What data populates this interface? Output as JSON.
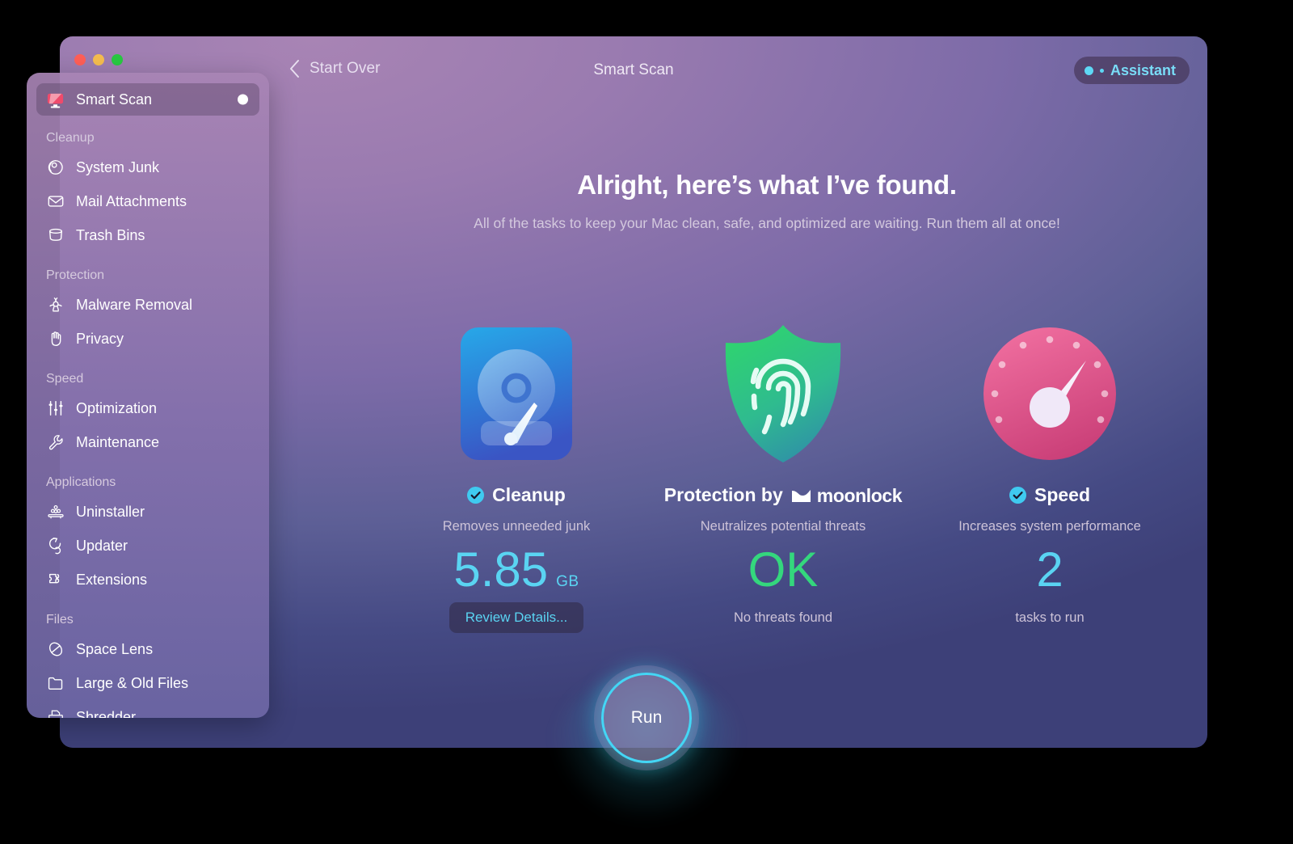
{
  "window": {
    "title": "Smart Scan",
    "back_label": "Start Over",
    "assistant_label": "Assistant",
    "traffic_lights": [
      "close",
      "minimize",
      "zoom"
    ]
  },
  "hero": {
    "headline": "Alright, here’s what I’ve found.",
    "subtext": "All of the tasks to keep your Mac clean, safe, and optimized are waiting. Run them all at once!"
  },
  "cards": [
    {
      "id": "cleanup",
      "icon": "hard-drive-icon",
      "title": "Cleanup",
      "subtitle": "Removes unneeded junk",
      "value": "5.85",
      "unit": "GB",
      "note": "",
      "button": "Review Details...",
      "checked": true,
      "value_color": "#5ad4f2"
    },
    {
      "id": "protection",
      "icon": "shield-fingerprint-icon",
      "title": "Protection by",
      "brand": "moonlock",
      "subtitle": "Neutralizes potential threats",
      "value": "OK",
      "unit": "",
      "note": "No threats found",
      "button": "",
      "checked": false,
      "value_color": "#34d77d"
    },
    {
      "id": "speed",
      "icon": "speedometer-icon",
      "title": "Speed",
      "subtitle": "Increases system performance",
      "value": "2",
      "unit": "",
      "note": "tasks to run",
      "button": "",
      "checked": true,
      "value_color": "#5ad4f2"
    }
  ],
  "run_button": {
    "label": "Run"
  },
  "sidebar": {
    "top_item": {
      "label": "Smart Scan",
      "icon": "smart-scan-icon",
      "badge": "dot",
      "active": true
    },
    "groups": [
      {
        "label": "Cleanup",
        "items": [
          {
            "label": "System Junk",
            "icon": "system-junk-icon"
          },
          {
            "label": "Mail Attachments",
            "icon": "envelope-icon"
          },
          {
            "label": "Trash Bins",
            "icon": "trash-bin-icon"
          }
        ]
      },
      {
        "label": "Protection",
        "items": [
          {
            "label": "Malware Removal",
            "icon": "biohazard-icon"
          },
          {
            "label": "Privacy",
            "icon": "hand-icon"
          }
        ]
      },
      {
        "label": "Speed",
        "items": [
          {
            "label": "Optimization",
            "icon": "sliders-icon"
          },
          {
            "label": "Maintenance",
            "icon": "wrench-icon"
          }
        ]
      },
      {
        "label": "Applications",
        "items": [
          {
            "label": "Uninstaller",
            "icon": "uninstaller-icon"
          },
          {
            "label": "Updater",
            "icon": "updater-icon"
          },
          {
            "label": "Extensions",
            "icon": "puzzle-icon"
          }
        ]
      },
      {
        "label": "Files",
        "items": [
          {
            "label": "Space Lens",
            "icon": "space-lens-icon"
          },
          {
            "label": "Large & Old Files",
            "icon": "folder-icon"
          },
          {
            "label": "Shredder",
            "icon": "shredder-icon"
          }
        ]
      }
    ]
  },
  "colors": {
    "accent_cyan": "#5ad4f2",
    "accent_green": "#34d77d",
    "window_top": "#a884b4",
    "window_bottom": "#3d4078"
  }
}
